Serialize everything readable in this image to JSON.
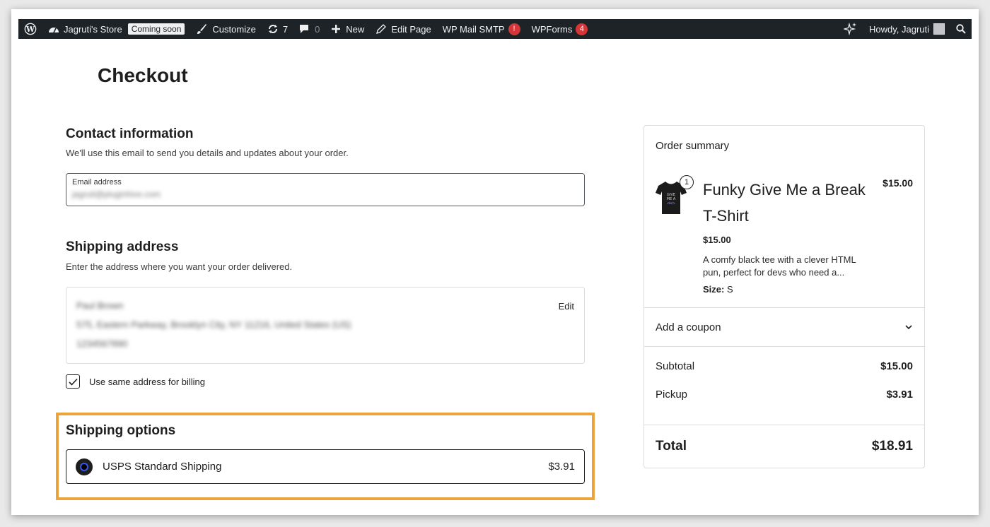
{
  "admin_bar": {
    "site_name": "Jagruti's Store",
    "coming_soon": "Coming soon",
    "customize": "Customize",
    "updates_count": "7",
    "comments_count": "0",
    "new_label": "New",
    "edit_page": "Edit Page",
    "smtp_label": "WP Mail SMTP",
    "smtp_alert": "!",
    "wpforms_label": "WPForms",
    "wpforms_count": "4",
    "howdy": "Howdy, Jagruti"
  },
  "page": {
    "title": "Checkout"
  },
  "contact": {
    "title": "Contact information",
    "description": "We'll use this email to send you details and updates about your order.",
    "email_label": "Email address",
    "email_value": "jagruti@pluginhive.com"
  },
  "shipping_address": {
    "title": "Shipping address",
    "description": "Enter the address where you want your order delivered.",
    "name": "Paul Brown",
    "address": "575, Eastern Parkway, Brooklyn City, NY 11216, United States (US)",
    "phone": "1234567890",
    "edit_label": "Edit",
    "billing_checkbox_label": "Use same address for billing"
  },
  "shipping_options": {
    "title": "Shipping options",
    "option_name": "USPS Standard Shipping",
    "option_price": "$3.91"
  },
  "order_summary": {
    "title": "Order summary",
    "quantity": "1",
    "product_name": "Funky Give Me a Break T-Shirt",
    "product_total": "$15.00",
    "product_price": "$15.00",
    "product_description": "A comfy black tee with a clever HTML pun, perfect for devs who need a...",
    "size_label": "Size:",
    "size_value": "S",
    "coupon_label": "Add a coupon",
    "subtotal_label": "Subtotal",
    "subtotal_value": "$15.00",
    "pickup_label": "Pickup",
    "pickup_value": "$3.91",
    "total_label": "Total",
    "total_value": "$18.91"
  },
  "colors": {
    "admin_bar": "#1d2327",
    "highlight": "#eba43c",
    "alert_red": "#d63638"
  }
}
